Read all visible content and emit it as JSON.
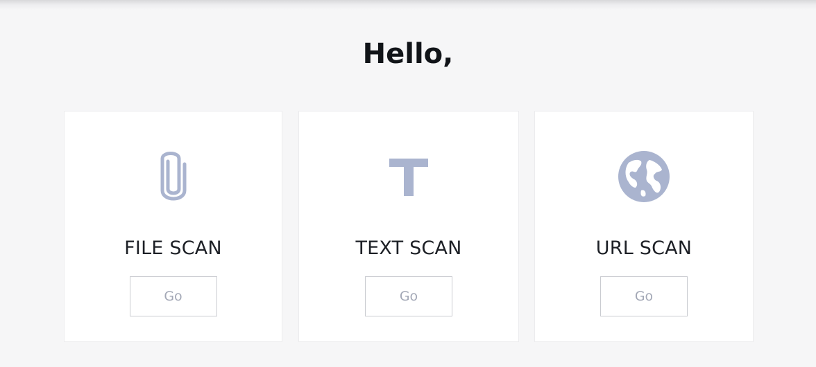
{
  "header": {
    "greeting": "Hello,"
  },
  "colors": {
    "background": "#f6f6f7",
    "card": "#ffffff",
    "icon": "#aab4cf",
    "title_text": "#1d2026",
    "button_text": "#a3a8b6",
    "button_border": "#c9cbd0"
  },
  "cards": [
    {
      "icon": "paperclip-icon",
      "title": "FILE SCAN",
      "button_label": "Go"
    },
    {
      "icon": "text-t-icon",
      "title": "TEXT SCAN",
      "button_label": "Go"
    },
    {
      "icon": "globe-icon",
      "title": "URL SCAN",
      "button_label": "Go"
    }
  ]
}
